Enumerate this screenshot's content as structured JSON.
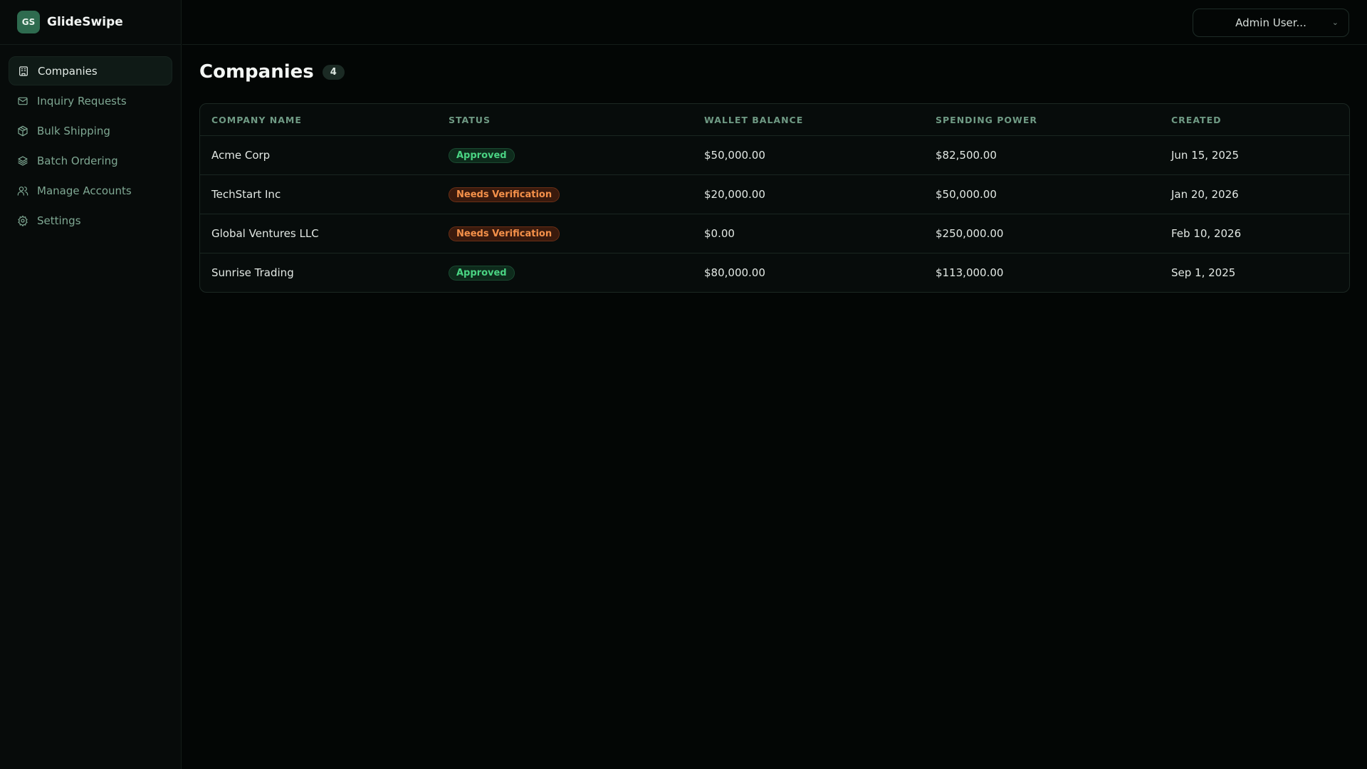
{
  "brand": {
    "initials": "GS",
    "name": "GlideSwipe"
  },
  "sidebar": {
    "items": [
      {
        "label": "Companies",
        "icon": "building-icon",
        "active": true
      },
      {
        "label": "Inquiry Requests",
        "icon": "mail-icon"
      },
      {
        "label": "Bulk Shipping",
        "icon": "package-icon"
      },
      {
        "label": "Batch Ordering",
        "icon": "layers-icon"
      },
      {
        "label": "Manage Accounts",
        "icon": "users-icon"
      },
      {
        "label": "Settings",
        "icon": "gear-icon"
      }
    ]
  },
  "header": {
    "user": "Admin User..."
  },
  "page": {
    "title": "Companies",
    "count": "4"
  },
  "table": {
    "columns": [
      "COMPANY NAME",
      "STATUS",
      "WALLET BALANCE",
      "SPENDING POWER",
      "CREATED"
    ],
    "rows": [
      {
        "name": "Acme Corp",
        "status": "Approved",
        "wallet": "$50,000.00",
        "spending": "$82,500.00",
        "created": "Jun 15, 2025"
      },
      {
        "name": "TechStart Inc",
        "status": "Needs Verification",
        "wallet": "$20,000.00",
        "spending": "$50,000.00",
        "created": "Jan 20, 2026"
      },
      {
        "name": "Global Ventures LLC",
        "status": "Needs Verification",
        "wallet": "$0.00",
        "spending": "$250,000.00",
        "created": "Feb 10, 2026"
      },
      {
        "name": "Sunrise Trading",
        "status": "Approved",
        "wallet": "$80,000.00",
        "spending": "$113,000.00",
        "created": "Sep 1, 2025"
      }
    ]
  },
  "colors": {
    "approved": "#4ad483",
    "needs_verification": "#f5914a",
    "brand": "#2e6b4f"
  }
}
